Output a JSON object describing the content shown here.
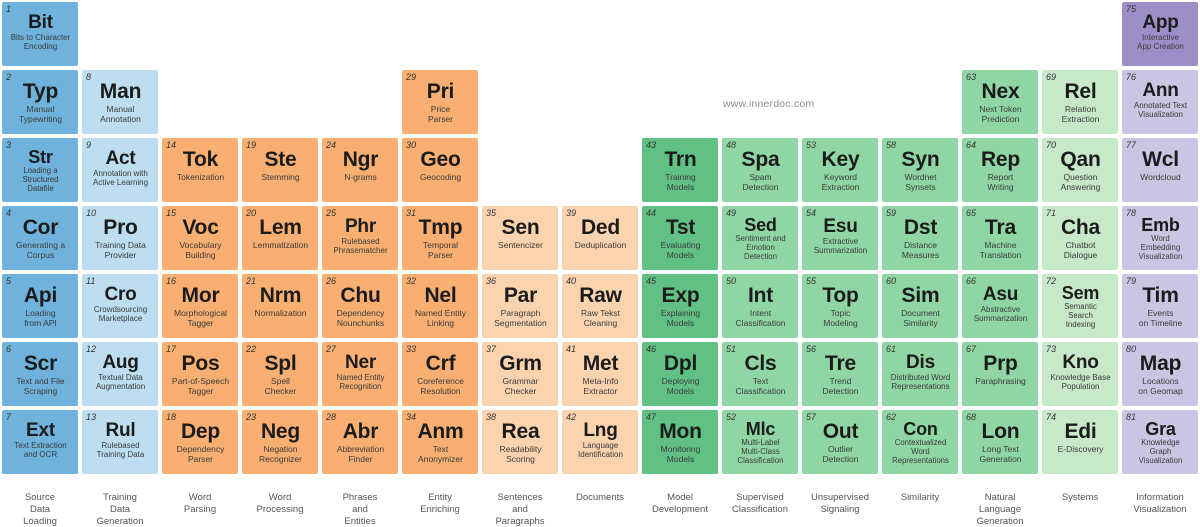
{
  "watermark": "www.innerdoc.com",
  "palette": {
    "blue_dark": "#6FB3DC",
    "blue_light": "#BDDDF0",
    "orange": "#F8AF71",
    "orange_light": "#FBD3AE",
    "green_dark": "#61C184",
    "green_mid": "#8FD6A4",
    "green_light": "#C7E8C9",
    "purple_dark": "#9C8FC7",
    "purple_light": "#C9C6E3"
  },
  "columns": [
    {
      "index": 1,
      "label": "Source\nData\nLoading"
    },
    {
      "index": 2,
      "label": "Training\nData\nGeneration"
    },
    {
      "index": 3,
      "label": "Word\nParsing"
    },
    {
      "index": 4,
      "label": "Word\nProcessing"
    },
    {
      "index": 5,
      "label": "Phrases\nand\nEntities"
    },
    {
      "index": 6,
      "label": "Entity\nEnriching"
    },
    {
      "index": 7,
      "label": "Sentences\nand\nParagraphs"
    },
    {
      "index": 8,
      "label": "Documents"
    },
    {
      "index": 9,
      "label": "Model\nDevelopment"
    },
    {
      "index": 10,
      "label": "Supervised\nClassification"
    },
    {
      "index": 11,
      "label": "Unsupervised\nSignaling"
    },
    {
      "index": 12,
      "label": "Similarity"
    },
    {
      "index": 13,
      "label": "Natural\nLanguage\nGeneration"
    },
    {
      "index": 14,
      "label": "Systems"
    },
    {
      "index": 15,
      "label": "Information\nVisualization"
    }
  ],
  "elements": [
    {
      "num": "1",
      "sym": "Bit",
      "desc": "Bits to Character\nEncoding",
      "col": 1,
      "row": 1,
      "color": "blue_dark"
    },
    {
      "num": "2",
      "sym": "Typ",
      "desc": "Manual\nTypewriting",
      "col": 1,
      "row": 2,
      "color": "blue_dark"
    },
    {
      "num": "3",
      "sym": "Str",
      "desc": "Loading a\nStructured\nDatafile",
      "col": 1,
      "row": 3,
      "color": "blue_dark"
    },
    {
      "num": "4",
      "sym": "Cor",
      "desc": "Generating a\nCorpus",
      "col": 1,
      "row": 4,
      "color": "blue_dark"
    },
    {
      "num": "5",
      "sym": "Api",
      "desc": "Loading\nfrom API",
      "col": 1,
      "row": 5,
      "color": "blue_dark"
    },
    {
      "num": "6",
      "sym": "Scr",
      "desc": "Text and File\nScraping",
      "col": 1,
      "row": 6,
      "color": "blue_dark"
    },
    {
      "num": "7",
      "sym": "Ext",
      "desc": "Text Extraction\nand OCR",
      "col": 1,
      "row": 7,
      "color": "blue_dark"
    },
    {
      "num": "8",
      "sym": "Man",
      "desc": "Manual\nAnnotation",
      "col": 2,
      "row": 2,
      "color": "blue_light"
    },
    {
      "num": "9",
      "sym": "Act",
      "desc": "Annotation with\nActive Learning",
      "col": 2,
      "row": 3,
      "color": "blue_light"
    },
    {
      "num": "10",
      "sym": "Pro",
      "desc": "Training Data\nProvider",
      "col": 2,
      "row": 4,
      "color": "blue_light"
    },
    {
      "num": "11",
      "sym": "Cro",
      "desc": "Crowdsourcing\nMarketplace",
      "col": 2,
      "row": 5,
      "color": "blue_light"
    },
    {
      "num": "12",
      "sym": "Aug",
      "desc": "Textual Data\nAugmentation",
      "col": 2,
      "row": 6,
      "color": "blue_light"
    },
    {
      "num": "13",
      "sym": "Rul",
      "desc": "Rulebased\nTraining Data",
      "col": 2,
      "row": 7,
      "color": "blue_light"
    },
    {
      "num": "14",
      "sym": "Tok",
      "desc": "Tokenization",
      "col": 3,
      "row": 3,
      "color": "orange"
    },
    {
      "num": "15",
      "sym": "Voc",
      "desc": "Vocabulary\nBuilding",
      "col": 3,
      "row": 4,
      "color": "orange"
    },
    {
      "num": "16",
      "sym": "Mor",
      "desc": "Morphological\nTagger",
      "col": 3,
      "row": 5,
      "color": "orange"
    },
    {
      "num": "17",
      "sym": "Pos",
      "desc": "Part-of-Speech\nTagger",
      "col": 3,
      "row": 6,
      "color": "orange"
    },
    {
      "num": "18",
      "sym": "Dep",
      "desc": "Dependency\nParser",
      "col": 3,
      "row": 7,
      "color": "orange"
    },
    {
      "num": "19",
      "sym": "Ste",
      "desc": "Stemming",
      "col": 4,
      "row": 3,
      "color": "orange"
    },
    {
      "num": "20",
      "sym": "Lem",
      "desc": "Lemmatization",
      "col": 4,
      "row": 4,
      "color": "orange"
    },
    {
      "num": "21",
      "sym": "Nrm",
      "desc": "Normalization",
      "col": 4,
      "row": 5,
      "color": "orange"
    },
    {
      "num": "22",
      "sym": "Spl",
      "desc": "Spell\nChecker",
      "col": 4,
      "row": 6,
      "color": "orange"
    },
    {
      "num": "23",
      "sym": "Neg",
      "desc": "Negation\nRecognizer",
      "col": 4,
      "row": 7,
      "color": "orange"
    },
    {
      "num": "24",
      "sym": "Ngr",
      "desc": "N-grams",
      "col": 5,
      "row": 3,
      "color": "orange"
    },
    {
      "num": "25",
      "sym": "Phr",
      "desc": "Rulebased\nPhrasematcher",
      "col": 5,
      "row": 4,
      "color": "orange"
    },
    {
      "num": "26",
      "sym": "Chu",
      "desc": "Dependency\nNounchunks",
      "col": 5,
      "row": 5,
      "color": "orange"
    },
    {
      "num": "27",
      "sym": "Ner",
      "desc": "Named Entity\nRecognition",
      "col": 5,
      "row": 6,
      "color": "orange"
    },
    {
      "num": "28",
      "sym": "Abr",
      "desc": "Abbreviation\nFinder",
      "col": 5,
      "row": 7,
      "color": "orange"
    },
    {
      "num": "29",
      "sym": "Pri",
      "desc": "Price\nParser",
      "col": 6,
      "row": 2,
      "color": "orange"
    },
    {
      "num": "30",
      "sym": "Geo",
      "desc": "Geocoding",
      "col": 6,
      "row": 3,
      "color": "orange"
    },
    {
      "num": "31",
      "sym": "Tmp",
      "desc": "Temporal\nParser",
      "col": 6,
      "row": 4,
      "color": "orange"
    },
    {
      "num": "32",
      "sym": "Nel",
      "desc": "Named Entity\nLinking",
      "col": 6,
      "row": 5,
      "color": "orange"
    },
    {
      "num": "33",
      "sym": "Crf",
      "desc": "Coreference\nResolution",
      "col": 6,
      "row": 6,
      "color": "orange"
    },
    {
      "num": "34",
      "sym": "Anm",
      "desc": "Text\nAnonymizer",
      "col": 6,
      "row": 7,
      "color": "orange"
    },
    {
      "num": "35",
      "sym": "Sen",
      "desc": "Sentencizer",
      "col": 7,
      "row": 4,
      "color": "orange_light"
    },
    {
      "num": "36",
      "sym": "Par",
      "desc": "Paragraph\nSegmentation",
      "col": 7,
      "row": 5,
      "color": "orange_light"
    },
    {
      "num": "37",
      "sym": "Grm",
      "desc": "Grammar\nChecker",
      "col": 7,
      "row": 6,
      "color": "orange_light"
    },
    {
      "num": "38",
      "sym": "Rea",
      "desc": "Readability\nScoring",
      "col": 7,
      "row": 7,
      "color": "orange_light"
    },
    {
      "num": "39",
      "sym": "Ded",
      "desc": "Deduplication",
      "col": 8,
      "row": 4,
      "color": "orange_light"
    },
    {
      "num": "40",
      "sym": "Raw",
      "desc": "Raw Tekst\nCleaning",
      "col": 8,
      "row": 5,
      "color": "orange_light"
    },
    {
      "num": "41",
      "sym": "Met",
      "desc": "Meta-Info\nExtractor",
      "col": 8,
      "row": 6,
      "color": "orange_light"
    },
    {
      "num": "42",
      "sym": "Lng",
      "desc": "Language\nIdentification",
      "col": 8,
      "row": 7,
      "color": "orange_light"
    },
    {
      "num": "43",
      "sym": "Trn",
      "desc": "Training\nModels",
      "col": 9,
      "row": 3,
      "color": "green_dark"
    },
    {
      "num": "44",
      "sym": "Tst",
      "desc": "Evaluating\nModels",
      "col": 9,
      "row": 4,
      "color": "green_dark"
    },
    {
      "num": "45",
      "sym": "Exp",
      "desc": "Explaining\nModels",
      "col": 9,
      "row": 5,
      "color": "green_dark"
    },
    {
      "num": "46",
      "sym": "Dpl",
      "desc": "Deploying\nModels",
      "col": 9,
      "row": 6,
      "color": "green_dark"
    },
    {
      "num": "47",
      "sym": "Mon",
      "desc": "Monitoring\nModels",
      "col": 9,
      "row": 7,
      "color": "green_dark"
    },
    {
      "num": "48",
      "sym": "Spa",
      "desc": "Spam\nDetection",
      "col": 10,
      "row": 3,
      "color": "green_mid"
    },
    {
      "num": "49",
      "sym": "Sed",
      "desc": "Sentiment and\nEmotion\nDetection",
      "col": 10,
      "row": 4,
      "color": "green_mid"
    },
    {
      "num": "50",
      "sym": "Int",
      "desc": "Intent\nClassification",
      "col": 10,
      "row": 5,
      "color": "green_mid"
    },
    {
      "num": "51",
      "sym": "Cls",
      "desc": "Text\nClassification",
      "col": 10,
      "row": 6,
      "color": "green_mid"
    },
    {
      "num": "52",
      "sym": "Mlc",
      "desc": "Multi-Label\nMulti-Class\nClassification",
      "col": 10,
      "row": 7,
      "color": "green_mid"
    },
    {
      "num": "53",
      "sym": "Key",
      "desc": "Keyword\nExtraction",
      "col": 11,
      "row": 3,
      "color": "green_mid"
    },
    {
      "num": "54",
      "sym": "Esu",
      "desc": "Extractive\nSummarization",
      "col": 11,
      "row": 4,
      "color": "green_mid"
    },
    {
      "num": "55",
      "sym": "Top",
      "desc": "Topic\nModeling",
      "col": 11,
      "row": 5,
      "color": "green_mid"
    },
    {
      "num": "56",
      "sym": "Tre",
      "desc": "Trend\nDetection",
      "col": 11,
      "row": 6,
      "color": "green_mid"
    },
    {
      "num": "57",
      "sym": "Out",
      "desc": "Outlier\nDetection",
      "col": 11,
      "row": 7,
      "color": "green_mid"
    },
    {
      "num": "58",
      "sym": "Syn",
      "desc": "Wordnet\nSynsets",
      "col": 12,
      "row": 3,
      "color": "green_mid"
    },
    {
      "num": "59",
      "sym": "Dst",
      "desc": "Distance\nMeasures",
      "col": 12,
      "row": 4,
      "color": "green_mid"
    },
    {
      "num": "60",
      "sym": "Sim",
      "desc": "Document\nSimilarity",
      "col": 12,
      "row": 5,
      "color": "green_mid"
    },
    {
      "num": "61",
      "sym": "Dis",
      "desc": "Distributed Word\nRepresentations",
      "col": 12,
      "row": 6,
      "color": "green_mid"
    },
    {
      "num": "62",
      "sym": "Con",
      "desc": "Contextualized\nWord\nRepresentations",
      "col": 12,
      "row": 7,
      "color": "green_mid"
    },
    {
      "num": "63",
      "sym": "Nex",
      "desc": "Next Token\nPrediction",
      "col": 13,
      "row": 2,
      "color": "green_mid"
    },
    {
      "num": "64",
      "sym": "Rep",
      "desc": "Report\nWriting",
      "col": 13,
      "row": 3,
      "color": "green_mid"
    },
    {
      "num": "65",
      "sym": "Tra",
      "desc": "Machine\nTranslation",
      "col": 13,
      "row": 4,
      "color": "green_mid"
    },
    {
      "num": "66",
      "sym": "Asu",
      "desc": "Abstractive\nSummarization",
      "col": 13,
      "row": 5,
      "color": "green_mid"
    },
    {
      "num": "67",
      "sym": "Prp",
      "desc": "Paraphrasing",
      "col": 13,
      "row": 6,
      "color": "green_mid"
    },
    {
      "num": "68",
      "sym": "Lon",
      "desc": "Long Text\nGeneration",
      "col": 13,
      "row": 7,
      "color": "green_mid"
    },
    {
      "num": "69",
      "sym": "Rel",
      "desc": "Relation\nExtraction",
      "col": 14,
      "row": 2,
      "color": "green_light"
    },
    {
      "num": "70",
      "sym": "Qan",
      "desc": "Question\nAnswering",
      "col": 14,
      "row": 3,
      "color": "green_light"
    },
    {
      "num": "71",
      "sym": "Cha",
      "desc": "Chatbot\nDialogue",
      "col": 14,
      "row": 4,
      "color": "green_light"
    },
    {
      "num": "72",
      "sym": "Sem",
      "desc": "Semantic\nSearch\nIndexing",
      "col": 14,
      "row": 5,
      "color": "green_light"
    },
    {
      "num": "73",
      "sym": "Kno",
      "desc": "Knowledge Base\nPopulation",
      "col": 14,
      "row": 6,
      "color": "green_light"
    },
    {
      "num": "74",
      "sym": "Edi",
      "desc": "E-Discovery",
      "col": 14,
      "row": 7,
      "color": "green_light"
    },
    {
      "num": "75",
      "sym": "App",
      "desc": "Interactive\nApp Creation",
      "col": 15,
      "row": 1,
      "color": "purple_dark"
    },
    {
      "num": "76",
      "sym": "Ann",
      "desc": "Annotated Text\nVisualization",
      "col": 15,
      "row": 2,
      "color": "purple_light"
    },
    {
      "num": "77",
      "sym": "Wcl",
      "desc": "Wordcloud",
      "col": 15,
      "row": 3,
      "color": "purple_light"
    },
    {
      "num": "78",
      "sym": "Emb",
      "desc": "Word\nEmbedding\nVisualization",
      "col": 15,
      "row": 4,
      "color": "purple_light"
    },
    {
      "num": "79",
      "sym": "Tim",
      "desc": "Events\non Timeline",
      "col": 15,
      "row": 5,
      "color": "purple_light"
    },
    {
      "num": "80",
      "sym": "Map",
      "desc": "Locations\non Geomap",
      "col": 15,
      "row": 6,
      "color": "purple_light"
    },
    {
      "num": "81",
      "sym": "Gra",
      "desc": "Knowledge\nGraph\nVisualization",
      "col": 15,
      "row": 7,
      "color": "purple_light"
    }
  ]
}
